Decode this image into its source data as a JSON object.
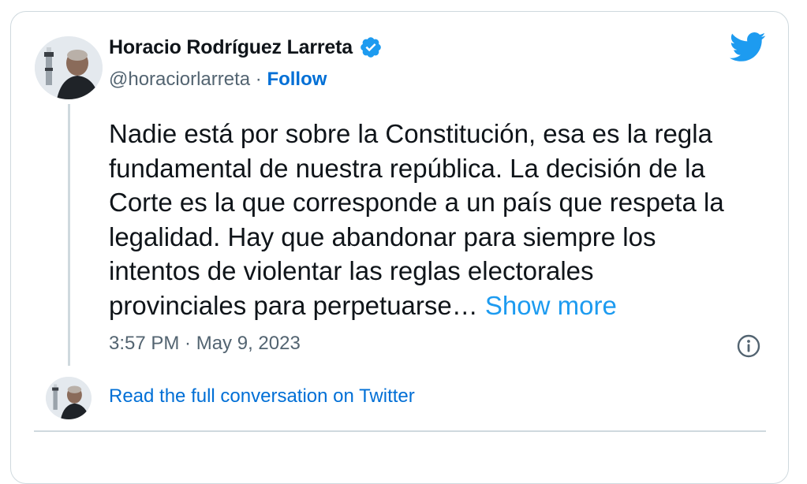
{
  "author": {
    "name": "Horacio Rodríguez Larreta",
    "handle": "@horaciorlarreta",
    "separator": " · ",
    "follow_label": "Follow"
  },
  "tweet": {
    "text": "Nadie está por sobre la Constitución, esa es la regla\nfundamental de nuestra república. La decisión de la\nCorte es la que corresponde a un país que respeta la\nlegalidad. Hay que abandonar para siempre los\nintentos de violentar las reglas electorales\nprovinciales para perpetuarse… ",
    "show_more_label": "Show more",
    "timestamp": "3:57 PM · May 9, 2023"
  },
  "footer": {
    "read_conversation_label": "Read the full conversation on Twitter"
  },
  "icons": {
    "brand": "twitter-bird-icon",
    "verified": "verified-badge-icon",
    "info": "info-icon"
  },
  "colors": {
    "twitter_blue": "#1d9bf0",
    "link_blue": "#006fd6",
    "text_primary": "#0f1419",
    "text_secondary": "#536471",
    "border": "#cfd9de"
  }
}
